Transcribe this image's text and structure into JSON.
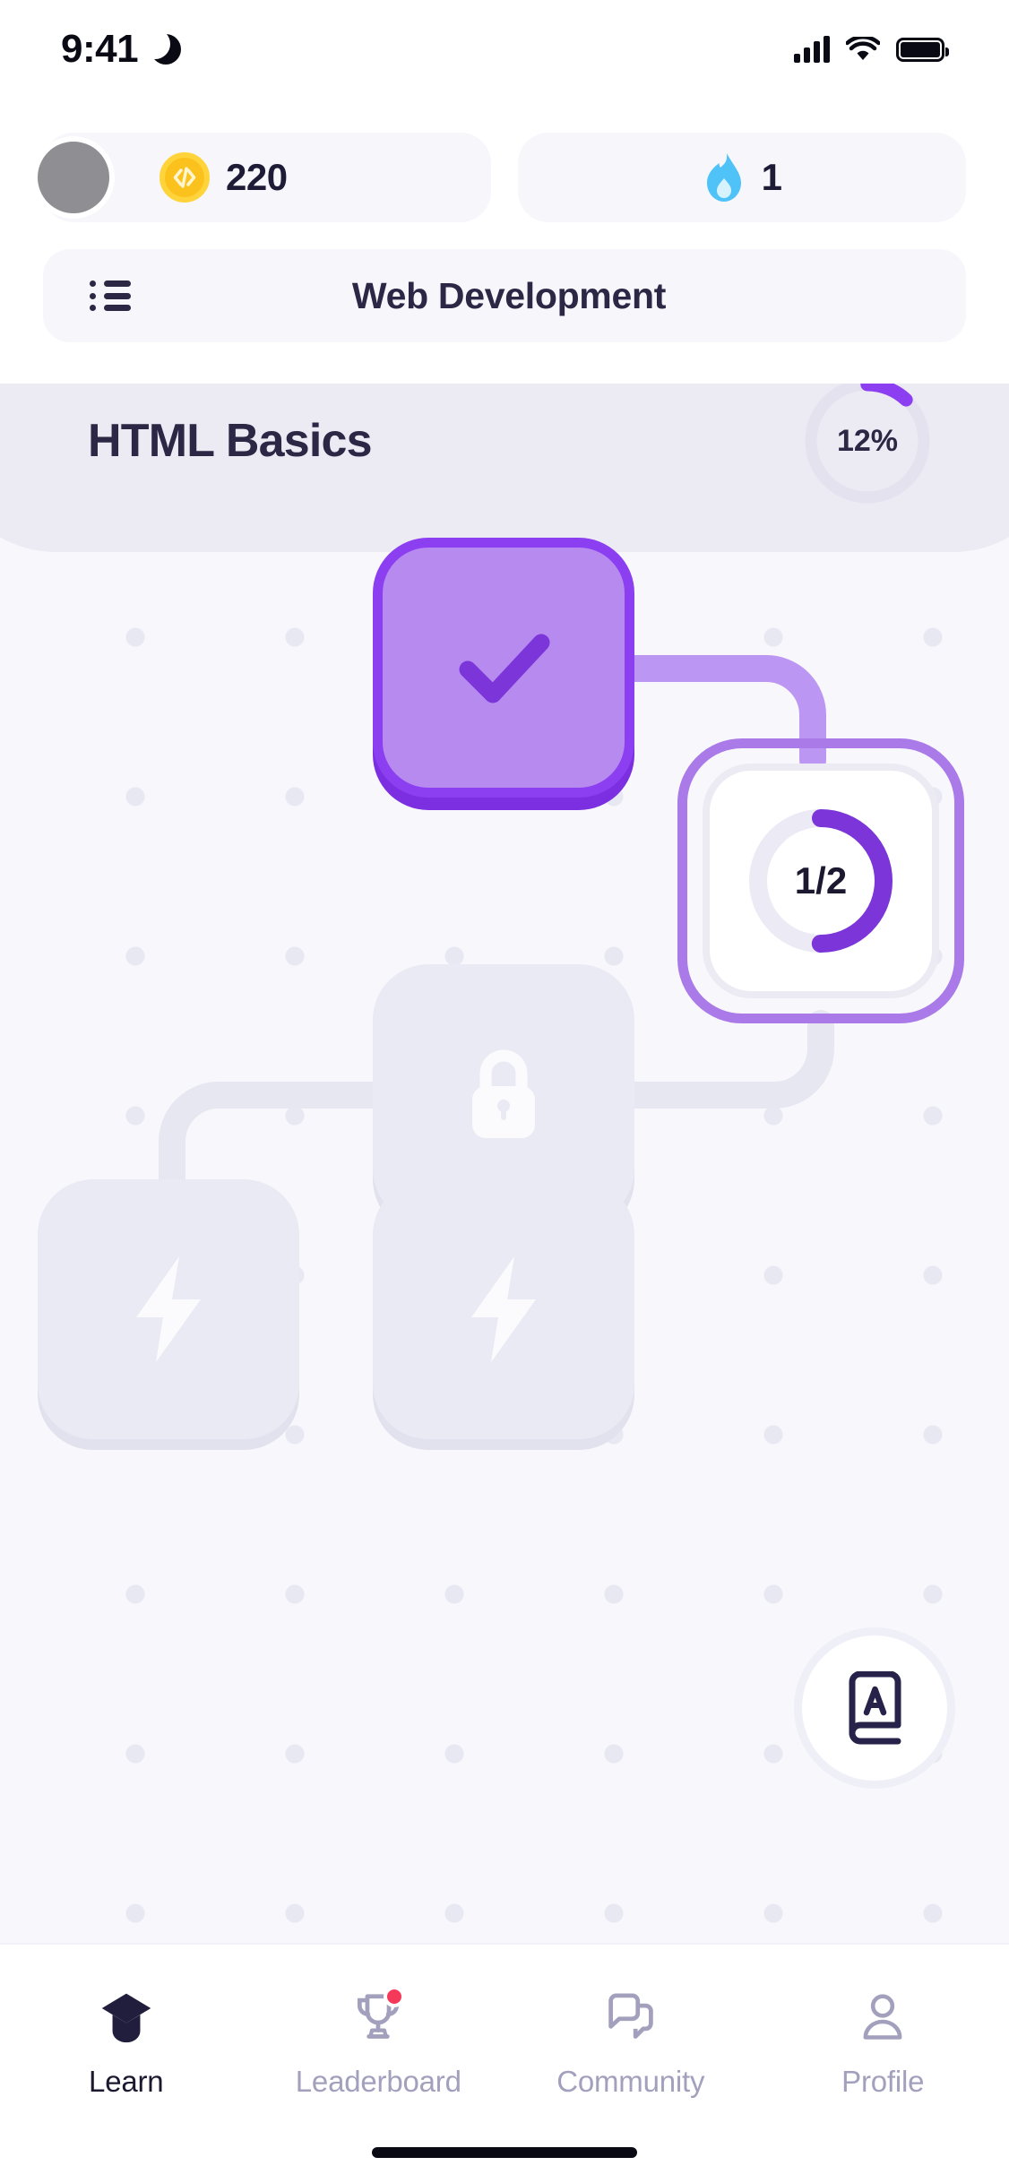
{
  "status_bar": {
    "time": "9:41",
    "moon_icon": "crescent-moon-icon",
    "signal_icon": "cellular-signal-icon",
    "wifi_icon": "wifi-icon",
    "battery_icon": "battery-full-icon"
  },
  "header": {
    "avatar": "user-avatar",
    "coins": {
      "icon": "code-coin-icon",
      "value": "220"
    },
    "streak": {
      "icon": "flame-icon",
      "value": "1"
    },
    "menu_icon": "list-menu-icon",
    "course_title": "Web Development"
  },
  "unit": {
    "title": "HTML Basics",
    "progress_label": "12%",
    "progress_percent": 12
  },
  "path_nodes": [
    {
      "id": "lesson-complete",
      "state": "completed",
      "icon": "check-icon",
      "label": ""
    },
    {
      "id": "lesson-current",
      "state": "in-progress",
      "icon": "progress-ring",
      "label": "1/2",
      "progress_percent": 50
    },
    {
      "id": "lesson-locked",
      "state": "locked",
      "icon": "lock-icon",
      "label": ""
    },
    {
      "id": "lesson-bolt-a",
      "state": "locked",
      "icon": "bolt-icon",
      "label": ""
    },
    {
      "id": "lesson-bolt-b",
      "state": "locked",
      "icon": "bolt-icon",
      "label": ""
    }
  ],
  "glossary_button": {
    "icon": "book-a-icon"
  },
  "tabbar": {
    "items": [
      {
        "label": "Learn",
        "icon": "graduation-cap-icon",
        "active": true,
        "badge": false
      },
      {
        "label": "Leaderboard",
        "icon": "trophy-icon",
        "active": false,
        "badge": true
      },
      {
        "label": "Community",
        "icon": "chat-bubbles-icon",
        "active": false,
        "badge": false
      },
      {
        "label": "Profile",
        "icon": "person-icon",
        "active": false,
        "badge": false
      }
    ]
  },
  "colors": {
    "accent_purple": "#8b3ff0",
    "accent_purple_light": "#b78af0",
    "accent_purple_border": "#a97ae8",
    "canvas_bg": "#f7f7fc",
    "dot_grid": "#e8e8f3",
    "banner_bg": "#ecebf4",
    "locked_node": "#eaeaf4",
    "text_dark": "#2b2745",
    "text_muted": "#a3a0bd",
    "coin_gold": "#fbc11c",
    "flame_blue": "#4fc3f7",
    "badge_red": "#f4395b"
  }
}
